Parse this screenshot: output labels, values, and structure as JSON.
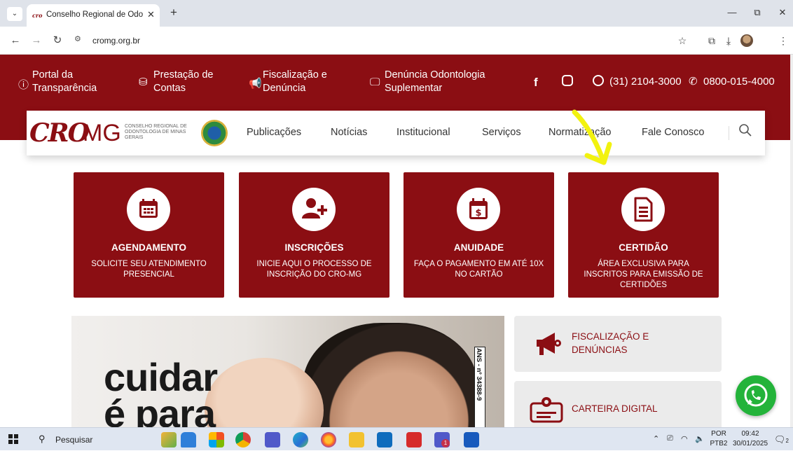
{
  "browser": {
    "tab_title": "Conselho Regional de Odontolc",
    "url": "cromg.org.br",
    "new_tab": "+",
    "close_tab": "✕",
    "tab_menu": "⌄",
    "win_min": "—",
    "win_restore": "⧉",
    "win_close": "✕"
  },
  "topbar": {
    "items": [
      {
        "icon": "info-icon",
        "line1": "Portal da",
        "line2": "Transparência"
      },
      {
        "icon": "coins-icon",
        "line1": "Prestação de",
        "line2": "Contas"
      },
      {
        "icon": "megaphone-icon",
        "line1": "Fiscalização e",
        "line2": "Denúncia"
      },
      {
        "icon": "monitor-icon",
        "line1": "Denúncia Odontologia",
        "line2": "Suplementar"
      }
    ],
    "whatsapp_phone": "(31) 2104-3000",
    "phone": "0800-015-4000"
  },
  "logo": {
    "cro": "CRO",
    "mg": "MG",
    "sub": "CONSELHO REGIONAL DE ODONTOLOGIA DE MINAS GERAIS"
  },
  "nav": {
    "links": [
      "Publicações",
      "Notícias",
      "Institucional",
      "Serviços",
      "Normatização",
      "Fale Conosco"
    ]
  },
  "cards": [
    {
      "title": "AGENDAMENTO",
      "desc": "SOLICITE SEU ATENDIMENTO PRESENCIAL",
      "icon": "calendar-icon"
    },
    {
      "title": "INSCRIÇÕES",
      "desc": "INICIE AQUI O PROCESSO DE INSCRIÇÃO DO CRO-MG",
      "icon": "user-plus-icon"
    },
    {
      "title": "ANUIDADE",
      "desc": "FAÇA O PAGAMENTO EM ATÉ 10X NO CARTÃO",
      "icon": "calendar-dollar-icon"
    },
    {
      "title": "CERTIDÃO",
      "desc": "ÁREA EXCLUSIVA PARA INSCRITOS PARA EMISSÃO DE CERTIDÕES",
      "icon": "document-icon"
    }
  ],
  "hero": {
    "line1": "cuidar",
    "line2": "é para",
    "ans": "ANS - nº 34388-9"
  },
  "side": [
    {
      "label": "FISCALIZAÇÃO E DENÚNCIAS",
      "icon": "megaphone-icon"
    },
    {
      "label": "CARTEIRA DIGITAL",
      "icon": "id-card-icon"
    }
  ],
  "taskbar": {
    "search": "Pesquisar",
    "lang_top": "POR",
    "lang_bottom": "PTB2",
    "time": "09:42",
    "date": "30/01/2025",
    "notif_count": "2",
    "teams_badge": "1"
  },
  "colors": {
    "brand": "#8b0e13",
    "whatsapp": "#23b33a",
    "annotation_arrow": "#f2f20f"
  }
}
